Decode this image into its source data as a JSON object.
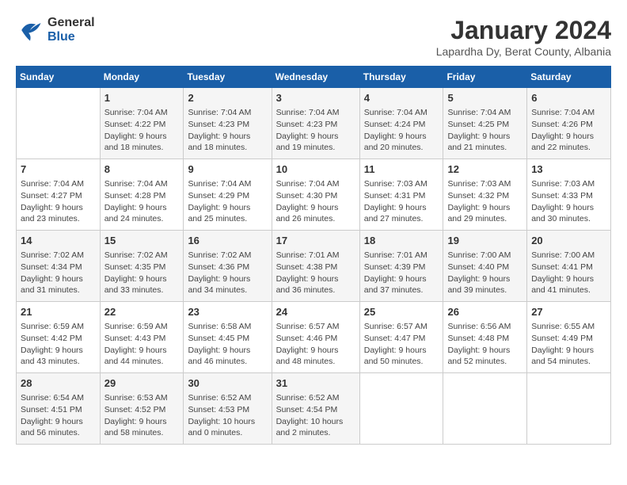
{
  "header": {
    "logo_general": "General",
    "logo_blue": "Blue",
    "month": "January 2024",
    "location": "Lapardha Dy, Berat County, Albania"
  },
  "days_of_week": [
    "Sunday",
    "Monday",
    "Tuesday",
    "Wednesday",
    "Thursday",
    "Friday",
    "Saturday"
  ],
  "weeks": [
    [
      {
        "day": "",
        "info": ""
      },
      {
        "day": "1",
        "info": "Sunrise: 7:04 AM\nSunset: 4:22 PM\nDaylight: 9 hours\nand 18 minutes."
      },
      {
        "day": "2",
        "info": "Sunrise: 7:04 AM\nSunset: 4:23 PM\nDaylight: 9 hours\nand 18 minutes."
      },
      {
        "day": "3",
        "info": "Sunrise: 7:04 AM\nSunset: 4:23 PM\nDaylight: 9 hours\nand 19 minutes."
      },
      {
        "day": "4",
        "info": "Sunrise: 7:04 AM\nSunset: 4:24 PM\nDaylight: 9 hours\nand 20 minutes."
      },
      {
        "day": "5",
        "info": "Sunrise: 7:04 AM\nSunset: 4:25 PM\nDaylight: 9 hours\nand 21 minutes."
      },
      {
        "day": "6",
        "info": "Sunrise: 7:04 AM\nSunset: 4:26 PM\nDaylight: 9 hours\nand 22 minutes."
      }
    ],
    [
      {
        "day": "7",
        "info": "Sunrise: 7:04 AM\nSunset: 4:27 PM\nDaylight: 9 hours\nand 23 minutes."
      },
      {
        "day": "8",
        "info": "Sunrise: 7:04 AM\nSunset: 4:28 PM\nDaylight: 9 hours\nand 24 minutes."
      },
      {
        "day": "9",
        "info": "Sunrise: 7:04 AM\nSunset: 4:29 PM\nDaylight: 9 hours\nand 25 minutes."
      },
      {
        "day": "10",
        "info": "Sunrise: 7:04 AM\nSunset: 4:30 PM\nDaylight: 9 hours\nand 26 minutes."
      },
      {
        "day": "11",
        "info": "Sunrise: 7:03 AM\nSunset: 4:31 PM\nDaylight: 9 hours\nand 27 minutes."
      },
      {
        "day": "12",
        "info": "Sunrise: 7:03 AM\nSunset: 4:32 PM\nDaylight: 9 hours\nand 29 minutes."
      },
      {
        "day": "13",
        "info": "Sunrise: 7:03 AM\nSunset: 4:33 PM\nDaylight: 9 hours\nand 30 minutes."
      }
    ],
    [
      {
        "day": "14",
        "info": "Sunrise: 7:02 AM\nSunset: 4:34 PM\nDaylight: 9 hours\nand 31 minutes."
      },
      {
        "day": "15",
        "info": "Sunrise: 7:02 AM\nSunset: 4:35 PM\nDaylight: 9 hours\nand 33 minutes."
      },
      {
        "day": "16",
        "info": "Sunrise: 7:02 AM\nSunset: 4:36 PM\nDaylight: 9 hours\nand 34 minutes."
      },
      {
        "day": "17",
        "info": "Sunrise: 7:01 AM\nSunset: 4:38 PM\nDaylight: 9 hours\nand 36 minutes."
      },
      {
        "day": "18",
        "info": "Sunrise: 7:01 AM\nSunset: 4:39 PM\nDaylight: 9 hours\nand 37 minutes."
      },
      {
        "day": "19",
        "info": "Sunrise: 7:00 AM\nSunset: 4:40 PM\nDaylight: 9 hours\nand 39 minutes."
      },
      {
        "day": "20",
        "info": "Sunrise: 7:00 AM\nSunset: 4:41 PM\nDaylight: 9 hours\nand 41 minutes."
      }
    ],
    [
      {
        "day": "21",
        "info": "Sunrise: 6:59 AM\nSunset: 4:42 PM\nDaylight: 9 hours\nand 43 minutes."
      },
      {
        "day": "22",
        "info": "Sunrise: 6:59 AM\nSunset: 4:43 PM\nDaylight: 9 hours\nand 44 minutes."
      },
      {
        "day": "23",
        "info": "Sunrise: 6:58 AM\nSunset: 4:45 PM\nDaylight: 9 hours\nand 46 minutes."
      },
      {
        "day": "24",
        "info": "Sunrise: 6:57 AM\nSunset: 4:46 PM\nDaylight: 9 hours\nand 48 minutes."
      },
      {
        "day": "25",
        "info": "Sunrise: 6:57 AM\nSunset: 4:47 PM\nDaylight: 9 hours\nand 50 minutes."
      },
      {
        "day": "26",
        "info": "Sunrise: 6:56 AM\nSunset: 4:48 PM\nDaylight: 9 hours\nand 52 minutes."
      },
      {
        "day": "27",
        "info": "Sunrise: 6:55 AM\nSunset: 4:49 PM\nDaylight: 9 hours\nand 54 minutes."
      }
    ],
    [
      {
        "day": "28",
        "info": "Sunrise: 6:54 AM\nSunset: 4:51 PM\nDaylight: 9 hours\nand 56 minutes."
      },
      {
        "day": "29",
        "info": "Sunrise: 6:53 AM\nSunset: 4:52 PM\nDaylight: 9 hours\nand 58 minutes."
      },
      {
        "day": "30",
        "info": "Sunrise: 6:52 AM\nSunset: 4:53 PM\nDaylight: 10 hours\nand 0 minutes."
      },
      {
        "day": "31",
        "info": "Sunrise: 6:52 AM\nSunset: 4:54 PM\nDaylight: 10 hours\nand 2 minutes."
      },
      {
        "day": "",
        "info": ""
      },
      {
        "day": "",
        "info": ""
      },
      {
        "day": "",
        "info": ""
      }
    ]
  ]
}
